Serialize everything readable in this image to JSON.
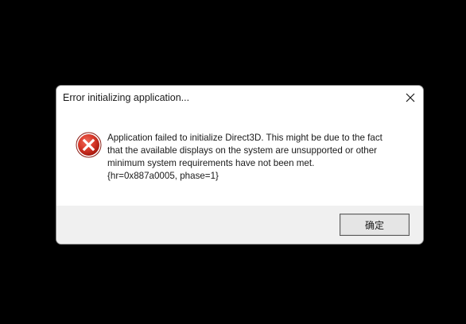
{
  "dialog": {
    "title": "Error initializing application...",
    "close_icon": "close-icon",
    "icon": "error-icon",
    "message": "Application failed to initialize Direct3D. This might be due to the fact\nthat the available displays on the system are unsupported or other\nminimum system requirements have not been met.\n{hr=0x887a0005, phase=1}",
    "ok_label": "确定"
  },
  "colors": {
    "backdrop": "#000000",
    "dialog_body": "#ffffff",
    "dialog_footer": "#f0f0f0",
    "error_red": "#c42b1c"
  }
}
